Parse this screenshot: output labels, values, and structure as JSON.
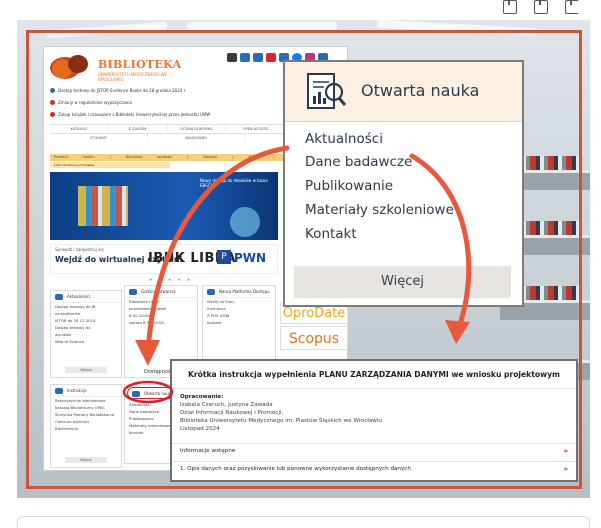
{
  "toolbar": {
    "icons": [
      "export-icon",
      "copy-icon",
      "share-icon"
    ]
  },
  "library": {
    "title": "BIBLIOTEKA",
    "subtitle": "UNIWERSYTETU MEDYCZNEGO WE WROCŁAWIU",
    "notices": [
      "Dostęp testowy do JSTOR Evidence Books do 28 grudnia 2024 r.",
      "Zmiany w regulaminie wypożyczania",
      "Zakup książek i czasopism z Biblioteki Uniwersyteckiej przez jednostki UMW"
    ],
    "nav1": [
      "KATALOG",
      "E-ZASOBY",
      "OCENA DOROBKU",
      "OPEN ACCESS",
      "O BIBLIOTECE"
    ],
    "nav2": [
      "STUDENT",
      "NAUKOWIEC",
      "PRACOWNIK"
    ],
    "yellowbar": "Przedłuż termin | Wirtualne wystawy | Nowości | Konto | Linki",
    "yellowbar2": "Lista zamówionych książek",
    "banner_text": "Nowy dostęp do ebooków w bazie EBSCO",
    "banner2": {
      "t1": "Sprawdź i zarejestruj się",
      "t2": "Wejdź do wirtualnej czytelni",
      "t3": "IBUK LIBRA",
      "t4": "PWN"
    },
    "cards": [
      {
        "title": "Aktualności",
        "lines": [
          "Dostęp testowy do JB",
          "na platformie",
          "JSTOR do 28.12.2024",
          "Dostęp testowy do",
          "wyników",
          "Web of Science"
        ],
        "button": "Więcej"
      },
      {
        "title": "Godziny otwarcia",
        "lines": [
          "Biblioteka UMW",
          "poniedziałek-piątek",
          "8:00-20:00",
          "sobota 8:30-15:00"
        ],
        "button": "Więcej"
      },
      {
        "title": "Nasza Platforma Dostępu",
        "lines": [
          "Wyślij do Sieci",
          "Instrukcja",
          "Z PHS UMW",
          "Kontakt"
        ],
        "button": "Więcej"
      },
      {
        "title": "Instrukcje",
        "lines": [
          "Repozytorium biblioteczne",
          "Katalog Biblioteczny OPAC",
          "Skrzynka Pomocy Bibliotekarza",
          "Centrum wydruku",
          "Bibliometria"
        ],
        "button": "Więcej"
      }
    ],
    "mini_on_title": "Otwarta nauka",
    "mini_on_links": [
      "Aktualności",
      "Dane badawcze",
      "Publikowanie",
      "Materiały szkoleniowe",
      "Kontakt"
    ],
    "dostepnosc": "Dostępność"
  },
  "side_logos": {
    "oprodate": "OproDate",
    "scopus": "Scopus"
  },
  "open_science_card": {
    "title": "Otwarta nauka",
    "links": [
      "Aktualności",
      "Dane badawcze",
      "Publikowanie",
      "Materiały szkoleniowe",
      "Kontakt"
    ],
    "more": "Więcej"
  },
  "document": {
    "title": "Krótka instrukcja wypełnienia PLANU ZARZĄDZANIA DANYMI we wniosku projektowym",
    "authors_label": "Opracowanie:",
    "authors": "Izabela Czeruch, Justyna Zawada",
    "department": "Dział Informacji Naukowej i Promocji,",
    "institution": "Biblioteka Uniwersytetu Medycznego im. Piastów Śląskich we Wrocławiu",
    "date": "Listopad 2024",
    "sections": [
      "Informacje wstępne",
      "1. Opis danych oraz pozyskiwanie lub ponowne wykorzystanie dostępnych danych"
    ]
  },
  "colors": {
    "frame": "#c9553b",
    "accent": "#d6212a",
    "card_header": "#fdf0e2"
  }
}
